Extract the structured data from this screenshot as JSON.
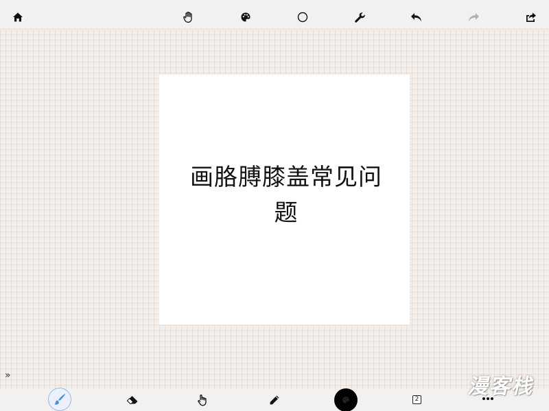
{
  "top_toolbar": {
    "icons": [
      "home-icon",
      "hand-icon",
      "palette-icon",
      "circle-icon",
      "wrench-icon",
      "undo-icon",
      "redo-icon",
      "share-icon"
    ]
  },
  "canvas": {
    "text": "画胳膊膝盖常见问题"
  },
  "bottom_toolbar": {
    "icons": [
      "brush-icon",
      "eraser-icon",
      "smudge-icon",
      "pencil-icon",
      "color-icon",
      "layers-icon",
      "more-icon"
    ],
    "layers_count": "2"
  },
  "sidebar_toggle": {
    "label": "»"
  },
  "watermark": {
    "text": "漫客栈"
  },
  "colors": {
    "toolbar_bg": "#f3f1ef",
    "workspace_bg": "#f3eeea",
    "canvas_bg": "#ffffff",
    "icon_active": "#4a90e2",
    "redo_disabled": "#b0b0b0"
  }
}
